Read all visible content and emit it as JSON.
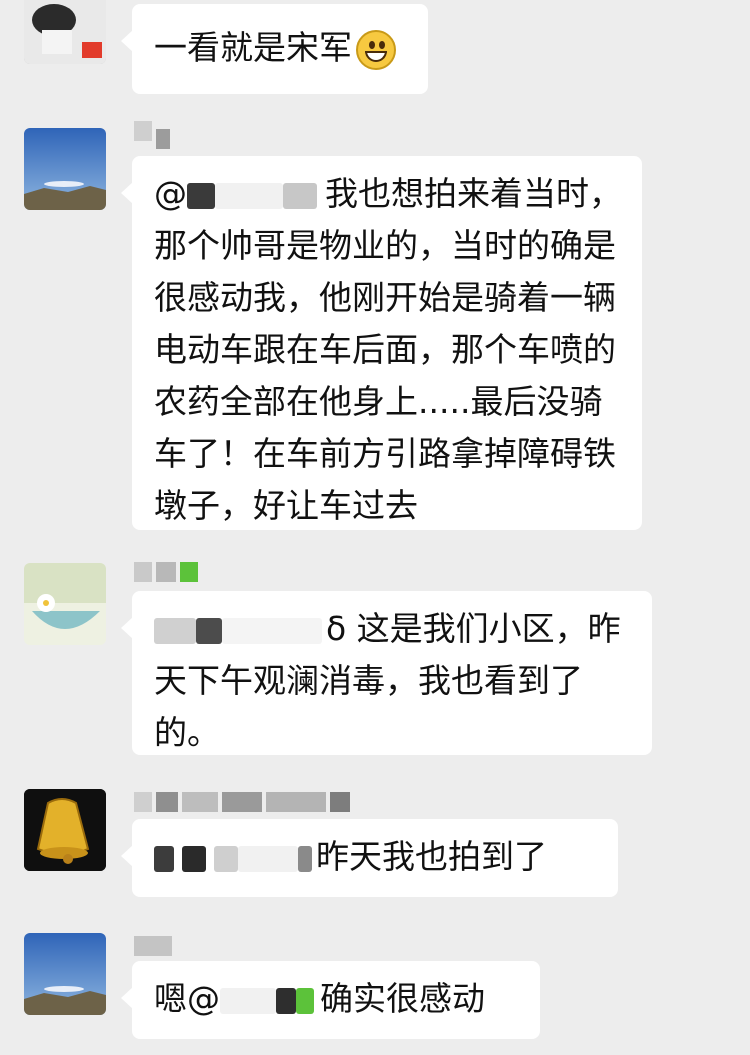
{
  "chat": {
    "messages": [
      {
        "text_before": "",
        "text": "一看就是宋军",
        "emoji": "grinning-emoji"
      },
      {
        "text_before": "@",
        "text": "我也想拍来着当时，那个帅哥是物业的，当时的确是很感动我，他刚开始是骑着一辆电动车跟在车后面，那个车喷的农药全部在他身上.....最后没骑车了！在车前方引路拿掉障碍铁墩子，好让车过去"
      },
      {
        "text_before": "",
        "text": "δ 这是我们小区，昨天下午观澜消毒，我也看到了的。"
      },
      {
        "text_before": "",
        "text": "昨天我也拍到了"
      },
      {
        "text_before": "嗯@",
        "text": "确实很感动"
      }
    ]
  },
  "colors": {
    "background": "#ededed",
    "bubble": "#ffffff",
    "text": "#111111",
    "mosaic_green": "#5cc23a"
  }
}
